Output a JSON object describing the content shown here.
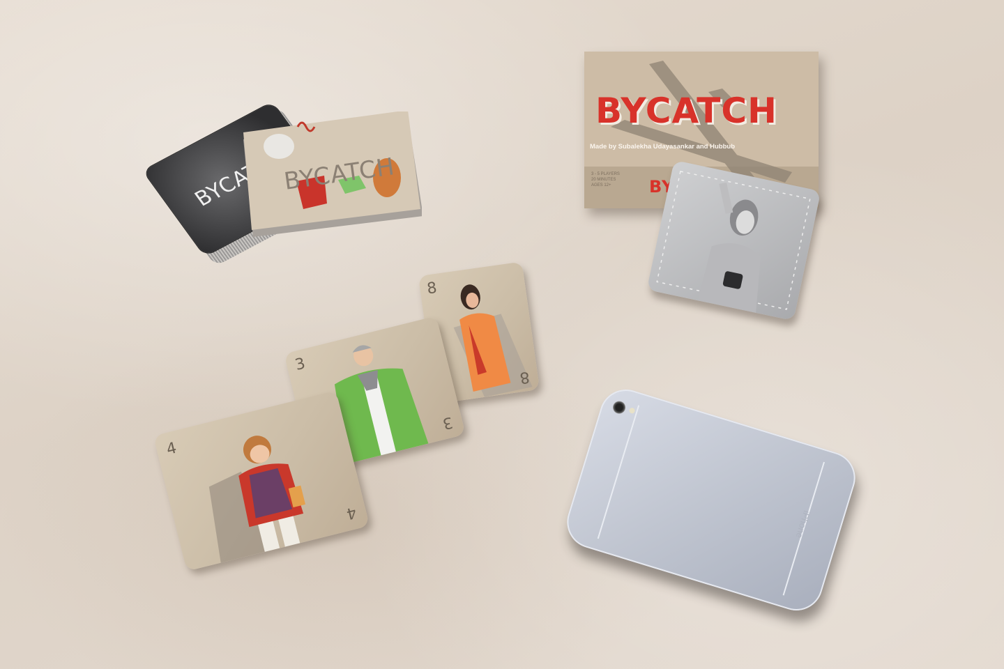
{
  "scene": {
    "description_text_visible": true,
    "colors": {
      "table": "#e3d9cf",
      "box": "#cdbca6",
      "brand_red": "#d8322a",
      "dark_deck": "#3a3a3c",
      "phone_silver": "#b9bfcc"
    }
  },
  "box": {
    "title": "BYCATCH",
    "credits": "Made by Subalekha Udayasankar and Hubbub",
    "side_title": "BYCATCH",
    "side_info": [
      "3 - 5 PLAYERS",
      "20 MINUTES",
      "AGES 12+"
    ]
  },
  "decks": {
    "dark_deck_title": "BYCATCH",
    "light_deck_title": "BYCATCH"
  },
  "cards": [
    {
      "id": "card-4",
      "number": "4"
    },
    {
      "id": "card-3",
      "number": "3"
    },
    {
      "id": "card-8",
      "number": "8"
    }
  ],
  "phone": {
    "engraving": "iPhone"
  }
}
